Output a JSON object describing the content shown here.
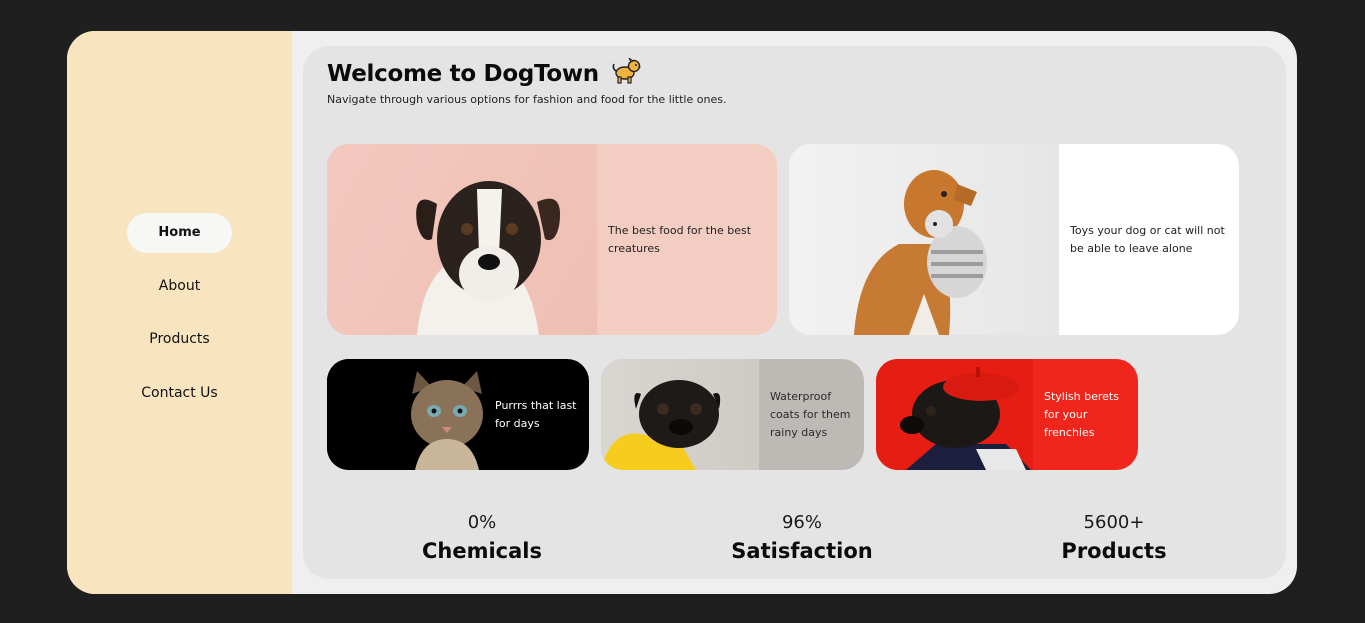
{
  "sidebar": {
    "items": [
      {
        "label": "Home",
        "active": true
      },
      {
        "label": "About"
      },
      {
        "label": "Products"
      },
      {
        "label": "Contact Us"
      }
    ]
  },
  "header": {
    "title": "Welcome to DogTown",
    "title_icon": "dog-emoji",
    "subtitle": "Navigate through various options for fashion and food for the little ones."
  },
  "cards": [
    {
      "text": "The best food for the best creatures",
      "image": "jack-russell-terrier-photo",
      "color": "#f3cdc2"
    },
    {
      "text": "Toys your dog or cat will not be able to leave alone",
      "image": "retriever-with-toy-photo",
      "color": "#ffffff"
    },
    {
      "text": "Purrrs that last for days",
      "image": "cat-photo",
      "color": "#000000"
    },
    {
      "text": "Waterproof coats for them rainy days",
      "image": "pug-in-yellow-coat-photo",
      "color": "#bdbab6"
    },
    {
      "text": "Stylish berets for your frenchies",
      "image": "pug-in-red-beret-photo",
      "color": "#f0261c"
    }
  ],
  "stats": [
    {
      "value": "0%",
      "label": "Chemicals"
    },
    {
      "value": "96%",
      "label": "Satisfaction"
    },
    {
      "value": "5600+",
      "label": "Products"
    }
  ],
  "colors": {
    "background": "#1f1f1f",
    "sidebar": "#f8e5bf",
    "main_panel": "#e4e4e4"
  }
}
